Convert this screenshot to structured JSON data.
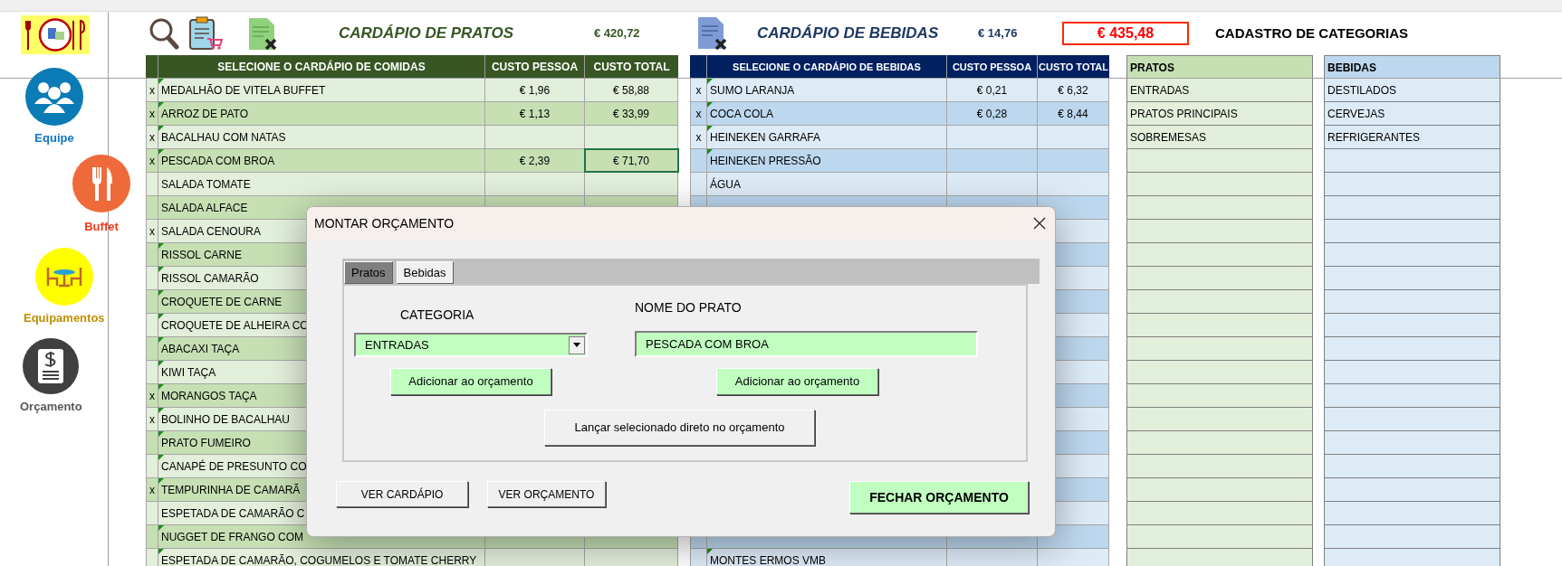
{
  "sidebar": {
    "items": [
      {
        "kind": "team",
        "label": "Equipe"
      },
      {
        "kind": "buffet",
        "label": "Buffet"
      },
      {
        "kind": "equipment",
        "label": "Equipamentos"
      },
      {
        "kind": "budget",
        "label": "Orçamento"
      }
    ]
  },
  "header": {
    "food_title": "CARDÁPIO DE PRATOS",
    "food_total": "€ 420,72",
    "drinks_title": "CARDÁPIO DE BEBIDAS",
    "drinks_total": "€ 14,76",
    "grand_total": "€ 435,48",
    "categories_title": "CADASTRO DE CATEGORIAS"
  },
  "food_table": {
    "columns": [
      "SELECIONE O CARDÁPIO DE  COMIDAS",
      "CUSTO PESSOA",
      "CUSTO TOTAL"
    ],
    "rows": [
      {
        "mark": "x",
        "name": "MEDALHÃO DE VITELA BUFFET",
        "cost_person": "€ 1,96",
        "cost_total": "€ 58,88",
        "flagged": true
      },
      {
        "mark": "x",
        "name": "ARROZ DE PATO",
        "cost_person": "€ 1,13",
        "cost_total": "€ 33,99",
        "flagged": true
      },
      {
        "mark": "x",
        "name": "BACALHAU COM NATAS",
        "flagged": true
      },
      {
        "mark": "x",
        "name": "PESCADA COM BROA",
        "cost_person": "€ 2,39",
        "cost_total": "€ 71,70",
        "flagged": true,
        "active": true
      },
      {
        "name": "SALADA TOMATE",
        "flagged": false
      },
      {
        "name": "SALADA ALFACE",
        "flagged": false
      },
      {
        "mark": "x",
        "name": "SALADA CENOURA",
        "flagged": false
      },
      {
        "name": "RISSOL CARNE",
        "flagged": true
      },
      {
        "name": "RISSOL CAMARÃO",
        "flagged": true
      },
      {
        "name": "CROQUETE DE CARNE",
        "flagged": true
      },
      {
        "name": "CROQUETE DE ALHEIRA CO",
        "flagged": true
      },
      {
        "name": "ABACAXI TAÇA",
        "flagged": true
      },
      {
        "name": "KIWI TAÇA",
        "flagged": true
      },
      {
        "mark": "x",
        "name": "MORANGOS TAÇA",
        "flagged": true
      },
      {
        "mark": "x",
        "name": "BOLINHO DE BACALHAU",
        "flagged": true
      },
      {
        "name": "PRATO FUMEIRO",
        "flagged": true
      },
      {
        "name": "CANAPÉ DE PRESUNTO CO",
        "flagged": true
      },
      {
        "mark": "x",
        "name": "TEMPURINHA DE CAMARÃ",
        "flagged": true
      },
      {
        "name": "ESPETADA DE CAMARÃO C",
        "flagged": false
      },
      {
        "name": "NUGGET DE FRANGO COM",
        "flagged": true
      },
      {
        "name": "ESPETADA DE CAMARÃO, COGUMELOS E TOMATE CHERRY",
        "flagged": true
      }
    ]
  },
  "drinks_table": {
    "columns": [
      "SELECIONE O CARDÁPIO DE BEBIDAS",
      "CUSTO PESSOA",
      "CUSTO TOTAL"
    ],
    "rows": [
      {
        "mark": "x",
        "name": "SUMO LARANJA",
        "cost_person": "€ 0,21",
        "cost_total": "€ 6,32",
        "flagged": true
      },
      {
        "mark": "x",
        "name": "COCA COLA",
        "cost_person": "€ 0,28",
        "cost_total": "€ 8,44",
        "flagged": true
      },
      {
        "mark": "x",
        "name": "HEINEKEN GARRAFA",
        "flagged": true
      },
      {
        "name": "HEINEKEN PRESSÃO",
        "flagged": true
      },
      {
        "name": "ÁGUA",
        "flagged": false
      },
      {},
      {},
      {},
      {},
      {},
      {},
      {},
      {},
      {},
      {},
      {},
      {},
      {},
      {},
      {},
      {
        "name": "MONTES ERMOS VMB",
        "flagged": true
      }
    ]
  },
  "categories": [
    {
      "kind": "food",
      "heading": "PRATOS",
      "items": [
        "ENTRADAS",
        "PRATOS PRINCIPAIS",
        "SOBREMESAS"
      ]
    },
    {
      "kind": "drinks",
      "heading": "BEBIDAS",
      "items": [
        "DESTILADOS",
        "CERVEJAS",
        "REFRIGERANTES"
      ]
    }
  ],
  "dialog": {
    "title": "MONTAR ORÇAMENTO",
    "tabs": [
      {
        "label": "Pratos",
        "selected": true
      },
      {
        "label": "Bebidas",
        "selected": false
      }
    ],
    "category_label": "CATEGORIA",
    "category_value": "ENTRADAS",
    "dish_label": "NOME DO PRATO",
    "dish_value": "PESCADA COM BROA",
    "add_buttons": [
      "Adicionar ao orçamento",
      "Adicionar ao orçamento"
    ],
    "launch_button": "Lançar selecionado direto no orçamento",
    "footer_buttons": [
      "VER CARDÁPIO",
      "VER ORÇAMENTO"
    ],
    "close_budget_button": "FECHAR ORÇAMENTO"
  }
}
